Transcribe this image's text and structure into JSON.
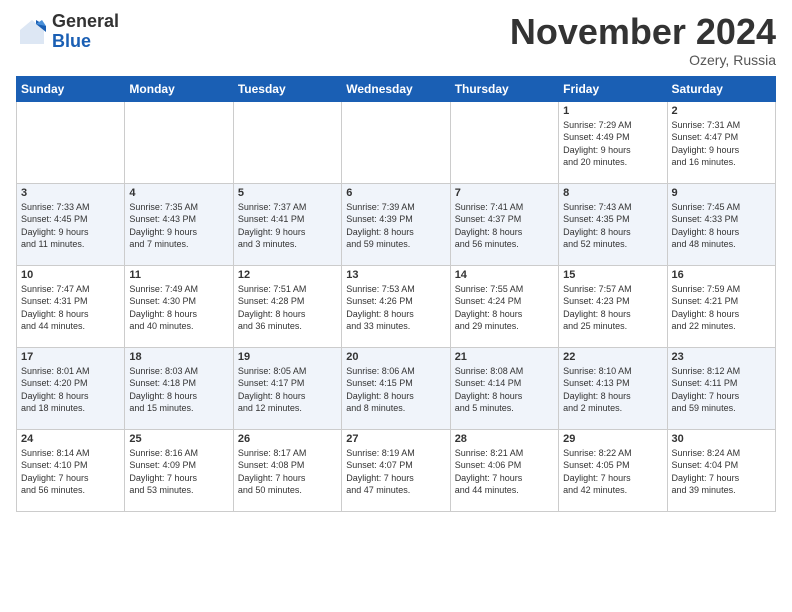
{
  "logo": {
    "general": "General",
    "blue": "Blue"
  },
  "title": "November 2024",
  "location": "Ozery, Russia",
  "days_of_week": [
    "Sunday",
    "Monday",
    "Tuesday",
    "Wednesday",
    "Thursday",
    "Friday",
    "Saturday"
  ],
  "weeks": [
    [
      {
        "day": "",
        "info": ""
      },
      {
        "day": "",
        "info": ""
      },
      {
        "day": "",
        "info": ""
      },
      {
        "day": "",
        "info": ""
      },
      {
        "day": "",
        "info": ""
      },
      {
        "day": "1",
        "info": "Sunrise: 7:29 AM\nSunset: 4:49 PM\nDaylight: 9 hours\nand 20 minutes."
      },
      {
        "day": "2",
        "info": "Sunrise: 7:31 AM\nSunset: 4:47 PM\nDaylight: 9 hours\nand 16 minutes."
      }
    ],
    [
      {
        "day": "3",
        "info": "Sunrise: 7:33 AM\nSunset: 4:45 PM\nDaylight: 9 hours\nand 11 minutes."
      },
      {
        "day": "4",
        "info": "Sunrise: 7:35 AM\nSunset: 4:43 PM\nDaylight: 9 hours\nand 7 minutes."
      },
      {
        "day": "5",
        "info": "Sunrise: 7:37 AM\nSunset: 4:41 PM\nDaylight: 9 hours\nand 3 minutes."
      },
      {
        "day": "6",
        "info": "Sunrise: 7:39 AM\nSunset: 4:39 PM\nDaylight: 8 hours\nand 59 minutes."
      },
      {
        "day": "7",
        "info": "Sunrise: 7:41 AM\nSunset: 4:37 PM\nDaylight: 8 hours\nand 56 minutes."
      },
      {
        "day": "8",
        "info": "Sunrise: 7:43 AM\nSunset: 4:35 PM\nDaylight: 8 hours\nand 52 minutes."
      },
      {
        "day": "9",
        "info": "Sunrise: 7:45 AM\nSunset: 4:33 PM\nDaylight: 8 hours\nand 48 minutes."
      }
    ],
    [
      {
        "day": "10",
        "info": "Sunrise: 7:47 AM\nSunset: 4:31 PM\nDaylight: 8 hours\nand 44 minutes."
      },
      {
        "day": "11",
        "info": "Sunrise: 7:49 AM\nSunset: 4:30 PM\nDaylight: 8 hours\nand 40 minutes."
      },
      {
        "day": "12",
        "info": "Sunrise: 7:51 AM\nSunset: 4:28 PM\nDaylight: 8 hours\nand 36 minutes."
      },
      {
        "day": "13",
        "info": "Sunrise: 7:53 AM\nSunset: 4:26 PM\nDaylight: 8 hours\nand 33 minutes."
      },
      {
        "day": "14",
        "info": "Sunrise: 7:55 AM\nSunset: 4:24 PM\nDaylight: 8 hours\nand 29 minutes."
      },
      {
        "day": "15",
        "info": "Sunrise: 7:57 AM\nSunset: 4:23 PM\nDaylight: 8 hours\nand 25 minutes."
      },
      {
        "day": "16",
        "info": "Sunrise: 7:59 AM\nSunset: 4:21 PM\nDaylight: 8 hours\nand 22 minutes."
      }
    ],
    [
      {
        "day": "17",
        "info": "Sunrise: 8:01 AM\nSunset: 4:20 PM\nDaylight: 8 hours\nand 18 minutes."
      },
      {
        "day": "18",
        "info": "Sunrise: 8:03 AM\nSunset: 4:18 PM\nDaylight: 8 hours\nand 15 minutes."
      },
      {
        "day": "19",
        "info": "Sunrise: 8:05 AM\nSunset: 4:17 PM\nDaylight: 8 hours\nand 12 minutes."
      },
      {
        "day": "20",
        "info": "Sunrise: 8:06 AM\nSunset: 4:15 PM\nDaylight: 8 hours\nand 8 minutes."
      },
      {
        "day": "21",
        "info": "Sunrise: 8:08 AM\nSunset: 4:14 PM\nDaylight: 8 hours\nand 5 minutes."
      },
      {
        "day": "22",
        "info": "Sunrise: 8:10 AM\nSunset: 4:13 PM\nDaylight: 8 hours\nand 2 minutes."
      },
      {
        "day": "23",
        "info": "Sunrise: 8:12 AM\nSunset: 4:11 PM\nDaylight: 7 hours\nand 59 minutes."
      }
    ],
    [
      {
        "day": "24",
        "info": "Sunrise: 8:14 AM\nSunset: 4:10 PM\nDaylight: 7 hours\nand 56 minutes."
      },
      {
        "day": "25",
        "info": "Sunrise: 8:16 AM\nSunset: 4:09 PM\nDaylight: 7 hours\nand 53 minutes."
      },
      {
        "day": "26",
        "info": "Sunrise: 8:17 AM\nSunset: 4:08 PM\nDaylight: 7 hours\nand 50 minutes."
      },
      {
        "day": "27",
        "info": "Sunrise: 8:19 AM\nSunset: 4:07 PM\nDaylight: 7 hours\nand 47 minutes."
      },
      {
        "day": "28",
        "info": "Sunrise: 8:21 AM\nSunset: 4:06 PM\nDaylight: 7 hours\nand 44 minutes."
      },
      {
        "day": "29",
        "info": "Sunrise: 8:22 AM\nSunset: 4:05 PM\nDaylight: 7 hours\nand 42 minutes."
      },
      {
        "day": "30",
        "info": "Sunrise: 8:24 AM\nSunset: 4:04 PM\nDaylight: 7 hours\nand 39 minutes."
      }
    ]
  ]
}
